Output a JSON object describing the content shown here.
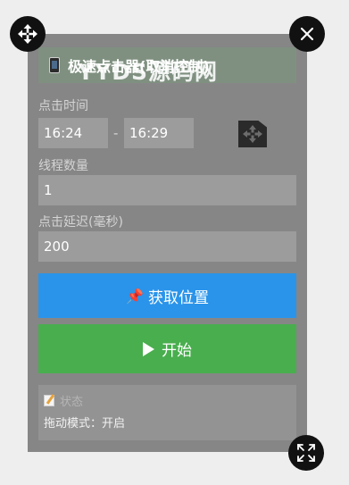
{
  "window": {
    "title": "极速点击器(取消控制)",
    "title_icon": "phone-icon"
  },
  "watermark": "YYDS源码网",
  "click_time": {
    "label": "点击时间",
    "start": "16:24",
    "separator": "-",
    "end": "16:29"
  },
  "threads": {
    "label": "线程数量",
    "value": "1"
  },
  "delay": {
    "label": "点击延迟(毫秒)",
    "value": "200"
  },
  "buttons": {
    "get_position": "获取位置",
    "get_position_icon": "pushpin-icon",
    "start": "开始",
    "start_icon": "play-icon"
  },
  "status": {
    "title": "状态",
    "title_icon": "memo-icon",
    "text": "拖动模式：开启"
  },
  "colors": {
    "panel": "#868686",
    "blue_button": "#2a94ea",
    "green_button": "#49ae4e"
  }
}
